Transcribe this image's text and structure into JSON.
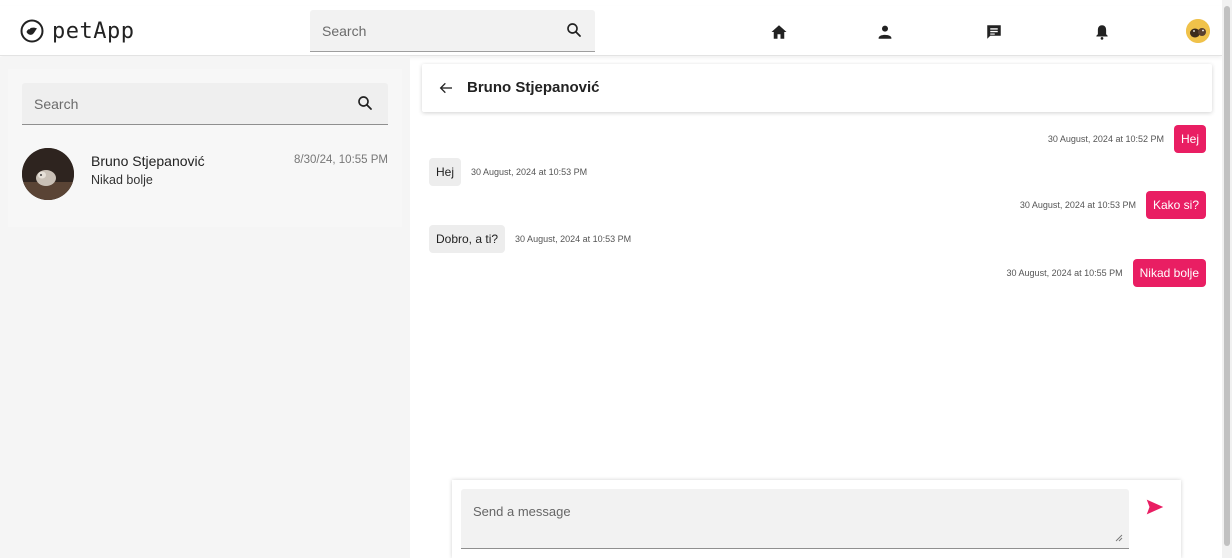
{
  "app": {
    "name": "petApp"
  },
  "topbar": {
    "search_placeholder": "Search",
    "nav": [
      "home-icon",
      "person-icon",
      "chat-icon",
      "bell-icon"
    ]
  },
  "sidebar": {
    "search_placeholder": "Search",
    "conversations": [
      {
        "name": "Bruno Stjepanović",
        "last_message": "Nikad bolje",
        "time": "8/30/24, 10:55 PM"
      }
    ]
  },
  "chat": {
    "title": "Bruno Stjepanović",
    "messages": [
      {
        "direction": "out",
        "text": "Hej",
        "timestamp": "30 August, 2024 at 10:52 PM"
      },
      {
        "direction": "in",
        "text": "Hej",
        "timestamp": "30 August, 2024 at 10:53 PM"
      },
      {
        "direction": "out",
        "text": "Kako si?",
        "timestamp": "30 August, 2024 at 10:53 PM"
      },
      {
        "direction": "in",
        "text": "Dobro, a ti?",
        "timestamp": "30 August, 2024 at 10:53 PM"
      },
      {
        "direction": "out",
        "text": "Nikad bolje",
        "timestamp": "30 August, 2024 at 10:55 PM"
      }
    ]
  },
  "composer": {
    "placeholder": "Send a message"
  },
  "colors": {
    "accent": "#e91e63",
    "incoming_bubble": "#ededed",
    "sidebar_bg": "#f5f5f5"
  }
}
